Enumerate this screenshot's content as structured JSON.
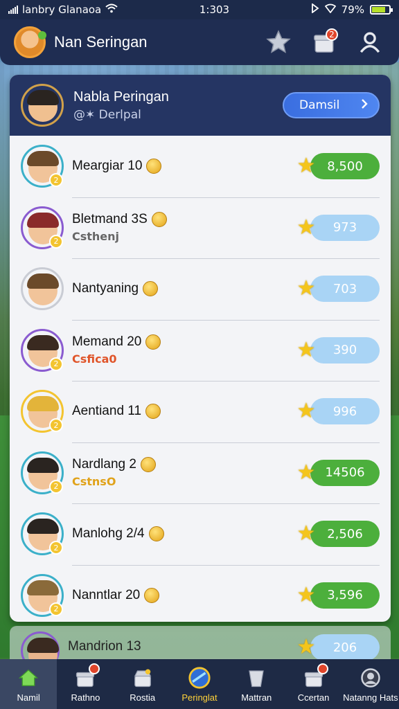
{
  "status_bar": {
    "carrier": "lanbry Glanaoa",
    "time": "1:303",
    "battery": "79%",
    "battery_level": 0.79
  },
  "header": {
    "title": "Nan Seringan",
    "avatar_icon": "user-avatar-icon",
    "icons": [
      "star-icon",
      "gift-box-icon",
      "profile-icon"
    ],
    "gift_badge": "2"
  },
  "leaderboard": {
    "current_user": {
      "name": "Nabla Peringan",
      "subtitle": "@✶ Derlpal",
      "button_label": "Damsil"
    },
    "rows": [
      {
        "name": "Meargiar 10",
        "sub": "",
        "sub_color": "#555555",
        "score": "8,500",
        "pill": "green",
        "rank_badge": "2"
      },
      {
        "name": "Bletmand 3S",
        "sub": "Csthenj",
        "sub_color": "#666666",
        "score": "973",
        "pill": "blue",
        "rank_badge": "2"
      },
      {
        "name": "Nantyaning",
        "sub": "",
        "sub_color": "#555555",
        "score": "703",
        "pill": "blue",
        "rank_badge": ""
      },
      {
        "name": "Memand 20",
        "sub": "Csfica0",
        "sub_color": "#e0552a",
        "score": "390",
        "pill": "blue",
        "rank_badge": "2"
      },
      {
        "name": "Aentiand 11",
        "sub": "",
        "sub_color": "#555555",
        "score": "996",
        "pill": "blue",
        "rank_badge": "2"
      },
      {
        "name": "Nardlang 2",
        "sub": "CstnsO",
        "sub_color": "#e0a21a",
        "score": "14506",
        "pill": "green",
        "rank_badge": "2"
      },
      {
        "name": "Manlohg 2/4",
        "sub": "",
        "sub_color": "#555555",
        "score": "2,506",
        "pill": "green",
        "rank_badge": "2"
      },
      {
        "name": "Nanntlar 20",
        "sub": "",
        "sub_color": "#555555",
        "score": "3,596",
        "pill": "green",
        "rank_badge": "2"
      }
    ],
    "peek_row": {
      "name": "Mandrion 13",
      "score": "206"
    }
  },
  "bottom_nav": {
    "items": [
      {
        "label": "Namil",
        "icon": "home-icon"
      },
      {
        "label": "Rathno",
        "icon": "gift-box-icon"
      },
      {
        "label": "Rostia",
        "icon": "chest-icon"
      },
      {
        "label": "Peringlat",
        "icon": "globe-icon"
      },
      {
        "label": "Mattran",
        "icon": "cup-icon"
      },
      {
        "label": "Ccertan",
        "icon": "reward-box-icon"
      },
      {
        "label": "Natanng Hats",
        "icon": "profile-icon"
      }
    ]
  },
  "colors": {
    "header_bg": "#1f2d52",
    "board_head_bg": "#253563",
    "pill_green": "#4caf3c",
    "pill_blue": "#a9d4f5",
    "star": "#f4c51c",
    "accent_button": "#3a6ee0"
  }
}
